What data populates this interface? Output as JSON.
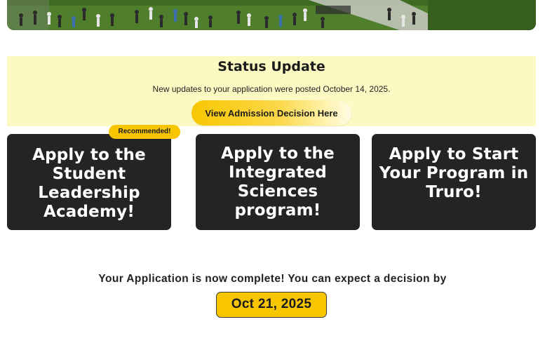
{
  "hero": {
    "image": "campus-lawn-crowd-photo"
  },
  "status": {
    "title": "Status Update",
    "message": "New updates to your application were posted October 14, 2025.",
    "button_label": "View Admission Decision Here"
  },
  "cards": [
    {
      "label": "Apply to the Student Leadership Academy!",
      "badge": "Recommended!"
    },
    {
      "label": "Apply to the Integrated Sciences program!"
    },
    {
      "label": "Apply to Start Your Program in Truro!"
    }
  ],
  "completion": {
    "message": "Your Application is now complete! You can expect a decision by",
    "date": "Oct 21, 2025"
  },
  "colors": {
    "accent": "#f7c600",
    "banner_bg": "#fcfac2",
    "card_bg": "#242424"
  }
}
